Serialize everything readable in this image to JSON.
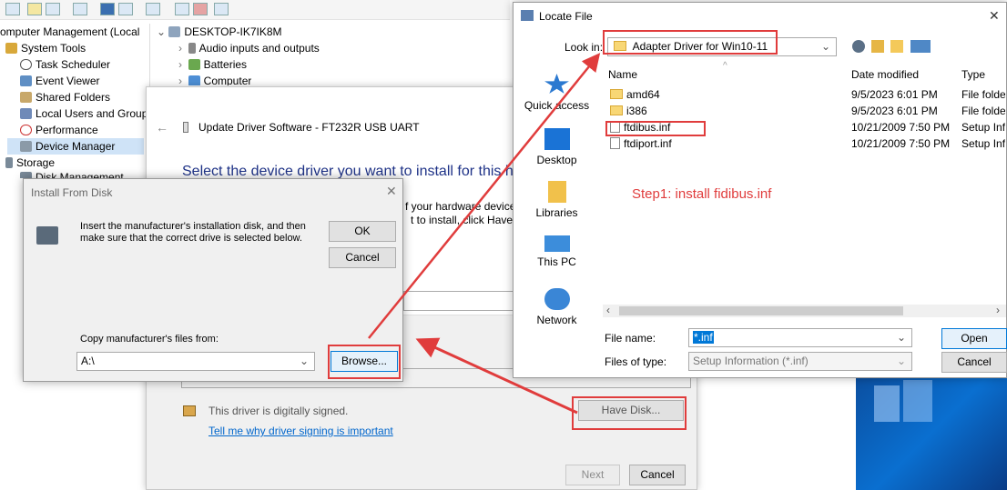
{
  "computer_management": {
    "title_fragment": "omputer Management (Local",
    "items": [
      {
        "label": "System Tools"
      },
      {
        "label": "Task Scheduler"
      },
      {
        "label": "Event Viewer"
      },
      {
        "label": "Shared Folders"
      },
      {
        "label": "Local Users and Groups"
      },
      {
        "label": "Performance"
      },
      {
        "label": "Device Manager"
      },
      {
        "label": "Storage"
      },
      {
        "label": "Disk Management"
      }
    ]
  },
  "device_tree": {
    "root": "DESKTOP-IK7IK8M",
    "items": [
      {
        "label": "Audio inputs and outputs"
      },
      {
        "label": "Batteries"
      },
      {
        "label": "Computer"
      }
    ]
  },
  "wizard": {
    "title": "Update Driver Software - FT232R USB UART",
    "heading": "Select the device driver you want to install for this ha",
    "body_line1": "f your hardware device",
    "body_line2": "t to install, click Have D",
    "signed_text": "This driver is digitally signed.",
    "signing_link": "Tell me why driver signing is important",
    "have_disk": "Have Disk...",
    "next": "Next",
    "cancel": "Cancel"
  },
  "install_from_disk": {
    "title": "Install From Disk",
    "message_line1": "Insert the manufacturer's installation disk, and then",
    "message_line2": "make sure that the correct drive is selected below.",
    "ok": "OK",
    "cancel": "Cancel",
    "copy_label": "Copy manufacturer's files from:",
    "path_value": "A:\\",
    "browse": "Browse..."
  },
  "locate_file": {
    "title": "Locate File",
    "look_in_label": "Look in:",
    "look_in_value": "Adapter Driver for Win10-11",
    "columns": {
      "name": "Name",
      "date": "Date modified",
      "type": "Type"
    },
    "files": [
      {
        "name": "amd64",
        "date": "9/5/2023 6:01 PM",
        "type": "File folder",
        "kind": "folder"
      },
      {
        "name": "i386",
        "date": "9/5/2023 6:01 PM",
        "type": "File folder",
        "kind": "folder"
      },
      {
        "name": "ftdibus.inf",
        "date": "10/21/2009 7:50 PM",
        "type": "Setup Info",
        "kind": "file"
      },
      {
        "name": "ftdiport.inf",
        "date": "10/21/2009 7:50 PM",
        "type": "Setup Info",
        "kind": "file"
      }
    ],
    "nav": [
      {
        "label": "Quick access"
      },
      {
        "label": "Desktop"
      },
      {
        "label": "Libraries"
      },
      {
        "label": "This PC"
      },
      {
        "label": "Network"
      }
    ],
    "file_name_label": "File name:",
    "file_name_value": "*.inf",
    "file_type_label": "Files of type:",
    "file_type_value": "Setup Information (*.inf)",
    "open": "Open",
    "cancel": "Cancel",
    "close_glyph": "✕"
  },
  "annotation": {
    "step1": "Step1: install fidibus.inf",
    "color": "#e03c3c"
  }
}
